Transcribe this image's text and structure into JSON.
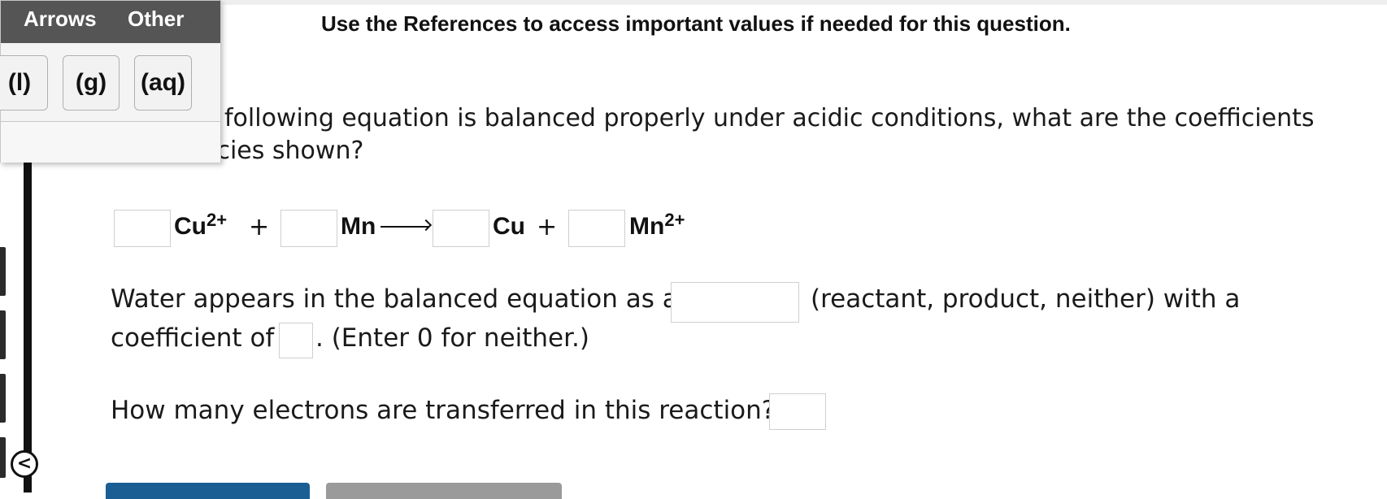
{
  "header": {
    "references_note": "Use the References to access important values if needed for this question."
  },
  "question": {
    "line1": "e following equation is balanced properly under acidic conditions, what are the coefficients",
    "line2": "ecies shown?"
  },
  "equation": {
    "species1": "Cu",
    "species1_charge": "2+",
    "plus1": "+",
    "species2": "Mn",
    "species3": "Cu",
    "plus2": "+",
    "species4": "Mn",
    "species4_charge": "2+"
  },
  "water": {
    "text_before": "Water appears in the balanced equation as a",
    "text_options": "(reactant, product, neither) with a",
    "text_coef": "coefficient of",
    "text_after": ". (Enter 0 for neither.)"
  },
  "electrons": {
    "question": "How many electrons are transferred in this reaction?"
  },
  "palette": {
    "tabs": [
      "Arrows",
      "Other"
    ],
    "buttons": [
      "(l)",
      "(g)",
      "(aq)"
    ]
  },
  "sidebar": {
    "collapse_glyph": "<"
  },
  "colors": {
    "primary_button": "#1b5e94",
    "secondary_button": "#9a9a9a",
    "palette_header": "#555555"
  }
}
